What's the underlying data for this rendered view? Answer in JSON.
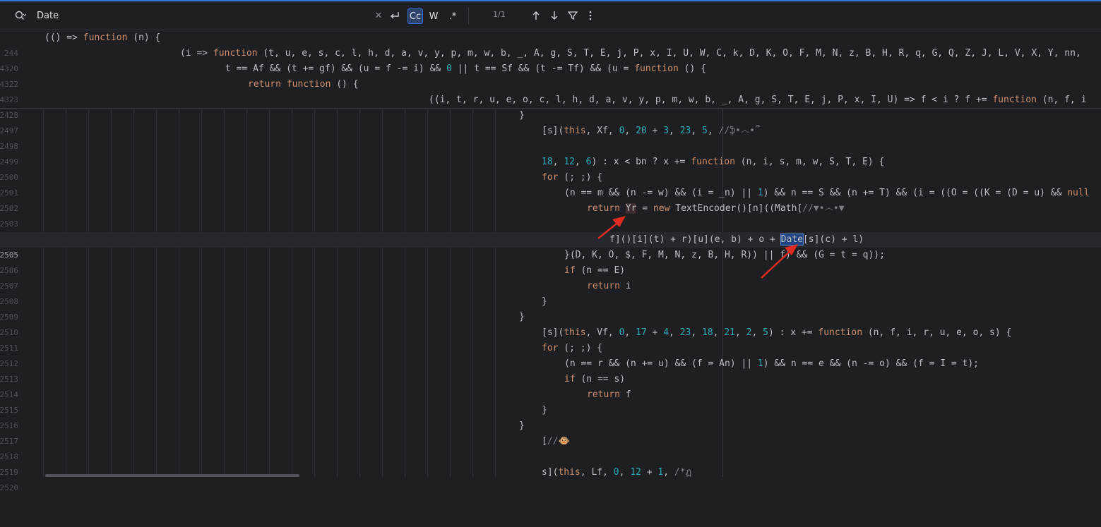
{
  "search": {
    "query": "Date",
    "match_count": "1/1",
    "match_case_label": "Cc",
    "words_label": "W",
    "regex_label": ".*"
  },
  "sticky_lines": [
    {
      "num": "244",
      "text": "(() => function (n) {"
    },
    {
      "num": "4320",
      "text": "(i => function (t, u, e, s, c, l, h, d, a, v, y, p, m, w, b, _, A, g, S, T, E, j, P, x, I, U, W, C, k, D, K, O, F, M, N, z, B, H, R, q, G, Q, Z, J, L, V, X, Y, nn,"
    },
    {
      "num": "4322",
      "text": "t == Af && (t += gf) && (u = f -= i) && 0 || t == Sf && (t -= Tf) && (u = function () {"
    },
    {
      "num": "4323",
      "text": "return function () {"
    },
    {
      "num": "2428",
      "text": "((i, t, r, u, e, o, c, l, h, d, a, v, y, p, m, w, b, _, A, g, S, T, E, j, P, x, I, U) => f < i ? f += function (n, f, i"
    }
  ],
  "lines": [
    {
      "num": "2497",
      "text": "}"
    },
    {
      "num": "2498",
      "text": "[s](this, Xf, 0, 20 + 3, 23, 5, //ֆ•෴•՞"
    },
    {
      "num": "2499",
      "text": ""
    },
    {
      "num": "2500",
      "text": "18, 12, 6) : x < bn ? x += function (n, i, s, m, w, S, T, E) {"
    },
    {
      "num": "2501",
      "text": "for (; ;) {"
    },
    {
      "num": "2502",
      "text": "(n == m && (n -= w) && (i = _n) || 1) && n == S && (n += T) && (i = ((O = ((K = (D = u) && null"
    },
    {
      "num": "2503",
      "text": "return Yr = new TextEncoder()[n]((Math[//▼•෴•▼"
    },
    {
      "num": "2504",
      "text": ""
    },
    {
      "num": "2505",
      "text": "f]()[i](t) + r)[u](e, b) + o + Date[s](c) + l)"
    },
    {
      "num": "2506",
      "text": "}(D, K, O, $, F, M, N, z, B, H, R)) || f) && (G = t = q));"
    },
    {
      "num": "2507",
      "text": "if (n == E)"
    },
    {
      "num": "2508",
      "text": "return i"
    },
    {
      "num": "2509",
      "text": "}"
    },
    {
      "num": "2510",
      "text": "}"
    },
    {
      "num": "2511",
      "text": "[s](this, Vf, 0, 17 + 4, 23, 18, 21, 2, 5) : x += function (n, f, i, r, u, e, o, s) {"
    },
    {
      "num": "2512",
      "text": "for (; ;) {"
    },
    {
      "num": "2513",
      "text": "(n == r && (n += u) && (f = An) || 1) && n == e && (n -= o) && (f = I = t);"
    },
    {
      "num": "2514",
      "text": "if (n == s)"
    },
    {
      "num": "2515",
      "text": "return f"
    },
    {
      "num": "2516",
      "text": "}"
    },
    {
      "num": "2517",
      "text": "}"
    },
    {
      "num": "2518",
      "text": "[//🐵"
    },
    {
      "num": "2519",
      "text": ""
    },
    {
      "num": "2520",
      "text": "s](this, Lf, 0, 12 + 1, /*ฏ"
    }
  ],
  "colors": {
    "background": "#1e1f22",
    "keyword": "#cf8e6d",
    "number": "#2aacb8",
    "comment": "#7a7e85",
    "search_hit": "#214283",
    "annotation_arrow": "#e02b20"
  },
  "icons": [
    "search-icon",
    "clear-icon",
    "newline-icon",
    "arrow-up-icon",
    "arrow-down-icon",
    "filter-icon",
    "more-icon"
  ]
}
